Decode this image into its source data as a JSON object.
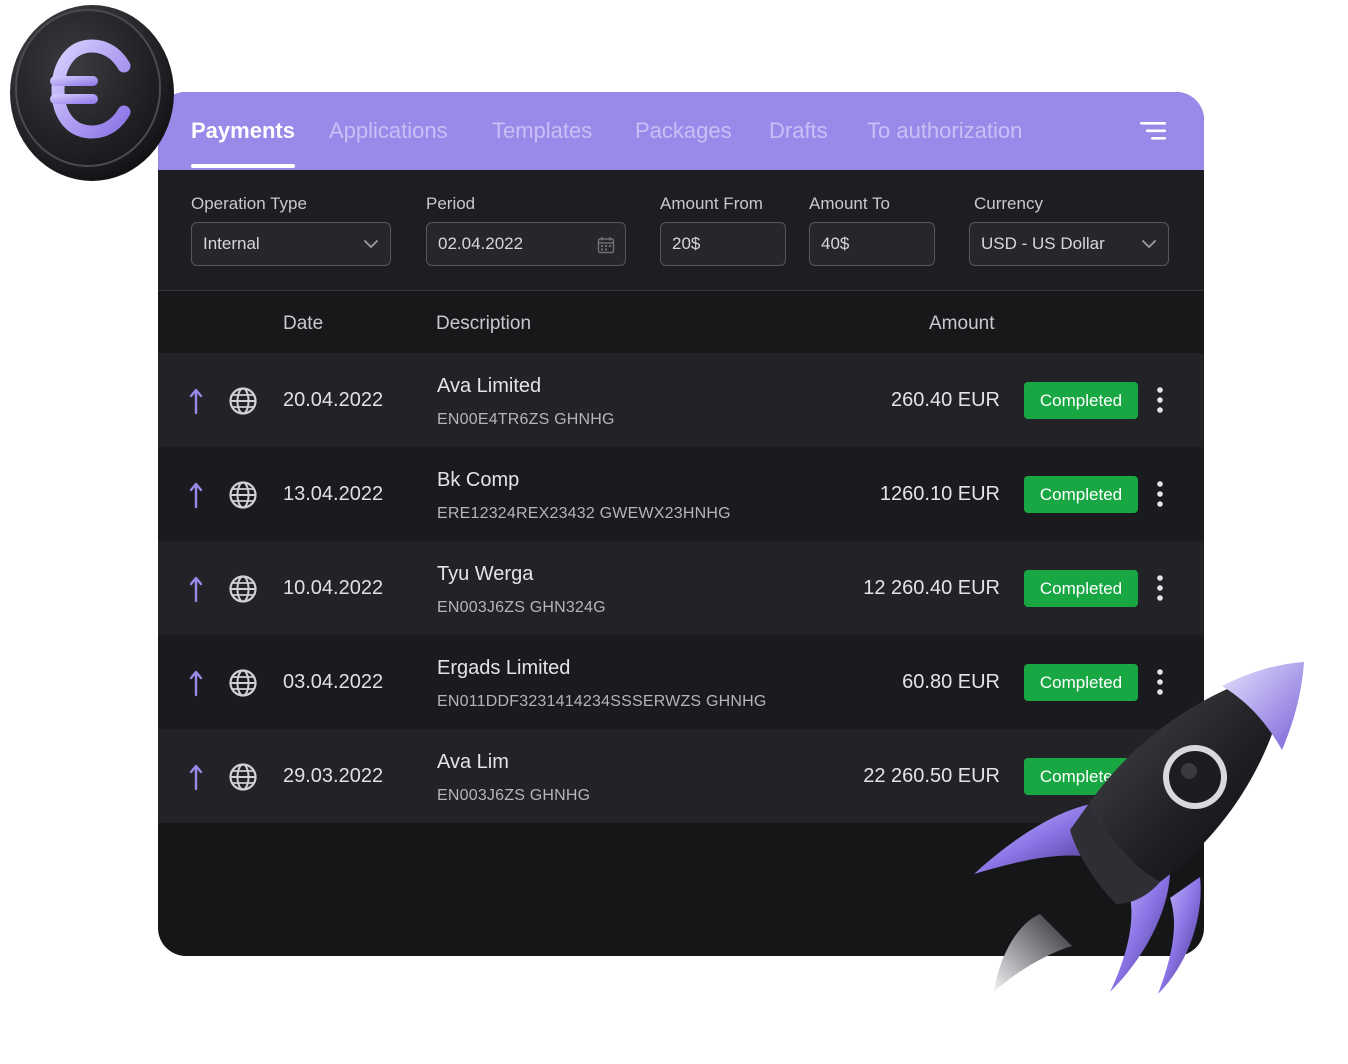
{
  "tabs": [
    {
      "label": "Payments"
    },
    {
      "label": "Applications"
    },
    {
      "label": "Templates"
    },
    {
      "label": "Packages"
    },
    {
      "label": "Drafts"
    },
    {
      "label": "To authorization"
    }
  ],
  "active_tab": "Payments",
  "filters": {
    "operation_type": {
      "label": "Operation Type",
      "value": "Internal"
    },
    "period": {
      "label": "Period",
      "value": "02.04.2022"
    },
    "amount_from": {
      "label": "Amount From",
      "value": "20$"
    },
    "amount_to": {
      "label": "Amount To",
      "value": "40$"
    },
    "currency": {
      "label": "Currency",
      "value": "USD - US Dollar"
    }
  },
  "table": {
    "headers": {
      "date": "Date",
      "description": "Description",
      "amount": "Amount"
    },
    "rows": [
      {
        "date": "20.04.2022",
        "name": "Ava Limited",
        "ref": "EN00E4TR6ZS GHNHG",
        "amount": "260.40 EUR",
        "status": "Completed"
      },
      {
        "date": "13.04.2022",
        "name": "Bk Comp",
        "ref": "ERE12324REX23432 GWEWX23HNHG",
        "amount": "1260.10 EUR",
        "status": "Completed"
      },
      {
        "date": "10.04.2022",
        "name": "Tyu Werga",
        "ref": "EN003J6ZS GHN324G",
        "amount": "12 260.40 EUR",
        "status": "Completed"
      },
      {
        "date": "03.04.2022",
        "name": "Ergads Limited",
        "ref": "EN011DDF3231414234SSSERWZS GHNHG",
        "amount": "60.80 EUR",
        "status": "Completed"
      },
      {
        "date": "29.03.2022",
        "name": "Ava Lim",
        "ref": "EN003J6ZS GHNHG",
        "amount": "22 260.50 EUR",
        "status": "Completed"
      }
    ]
  },
  "colors": {
    "tab_bar": "#9b89ea",
    "status_completed": "#19a744",
    "arrow_accent": "#9b89ea",
    "panel_bg": "#151618"
  },
  "icons": {
    "menu": "menu-lines-icon",
    "calendar": "calendar-icon",
    "chevron": "chevron-down-icon",
    "direction": "arrow-up-icon",
    "globe": "globe-icon",
    "more": "kebab-menu-icon",
    "coin": "euro-coin-icon",
    "rocket": "rocket-icon"
  }
}
